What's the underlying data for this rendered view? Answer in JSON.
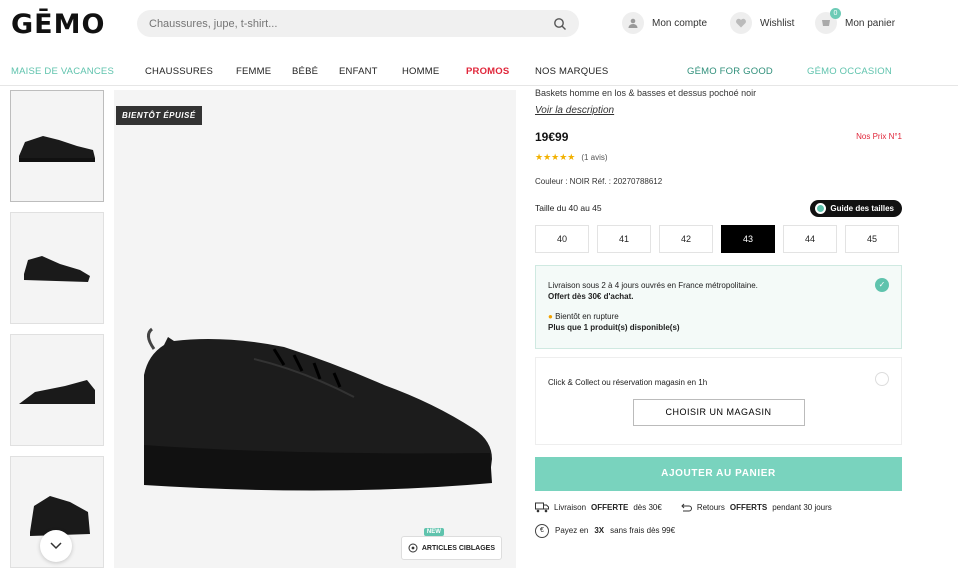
{
  "header": {
    "logo": "GĒMO",
    "search_placeholder": "Chaussures, jupe, t-shirt...",
    "account_label": "Mon compte",
    "wishlist_label": "Wishlist",
    "cart_label": "Mon panier",
    "cart_count": "0"
  },
  "nav": {
    "items": [
      "MAISE DE VACANCES",
      "CHAUSSURES",
      "FEMME",
      "BÉBÉ",
      "ENFANT",
      "HOMME",
      "PROMOS",
      "NOS MARQUES",
      "GÉMO FOR GOOD",
      "GÉMO OCCASION"
    ]
  },
  "gallery": {
    "tag": "BIENTÔT ÉPUISÉ",
    "recycled_new": "NEW",
    "recycled_label": "ARTICLES CIBLAGES"
  },
  "product": {
    "description": "Baskets homme en los & basses et dessus pochoé noir",
    "desc_link": "Voir la description",
    "price": "19€99",
    "rank": "Nos Prix N°1",
    "stars": "★★★★★",
    "review_count": "(1 avis)",
    "color_ref": "Couleur : NOIR   Réf. : 20270788612",
    "size_header": "Taille du 40 au 45",
    "size_guide": "Guide des tailles",
    "sizes": [
      "40",
      "41",
      "42",
      "43",
      "44",
      "45"
    ],
    "selected_size": "43"
  },
  "delivery": {
    "line1": "Livraison sous 2 à 4 jours ouvrés en France métropolitaine.",
    "line2": "Offert dès 30€ d'achat.",
    "warn1": "Bientôt en rupture",
    "warn2": "Plus que 1 produit(s) disponible(s)"
  },
  "clickcollect": {
    "text": "Click & Collect ou réservation magasin en 1h",
    "button": "CHOISIR UN MAGASIN"
  },
  "add_to_cart": "AJOUTER AU PANIER",
  "perks": {
    "delivery_pre": "Livraison",
    "delivery_bold": "OFFERTE",
    "delivery_post": "dès 30€",
    "return_pre": "Retours",
    "return_bold": "OFFERTS",
    "return_post": "pendant 30 jours",
    "pay_pre": "Payez en",
    "pay_bold": "3X",
    "pay_post": "sans frais dès 99€"
  },
  "colors": {
    "accent": "#79d3be",
    "promo": "#e0263a"
  }
}
